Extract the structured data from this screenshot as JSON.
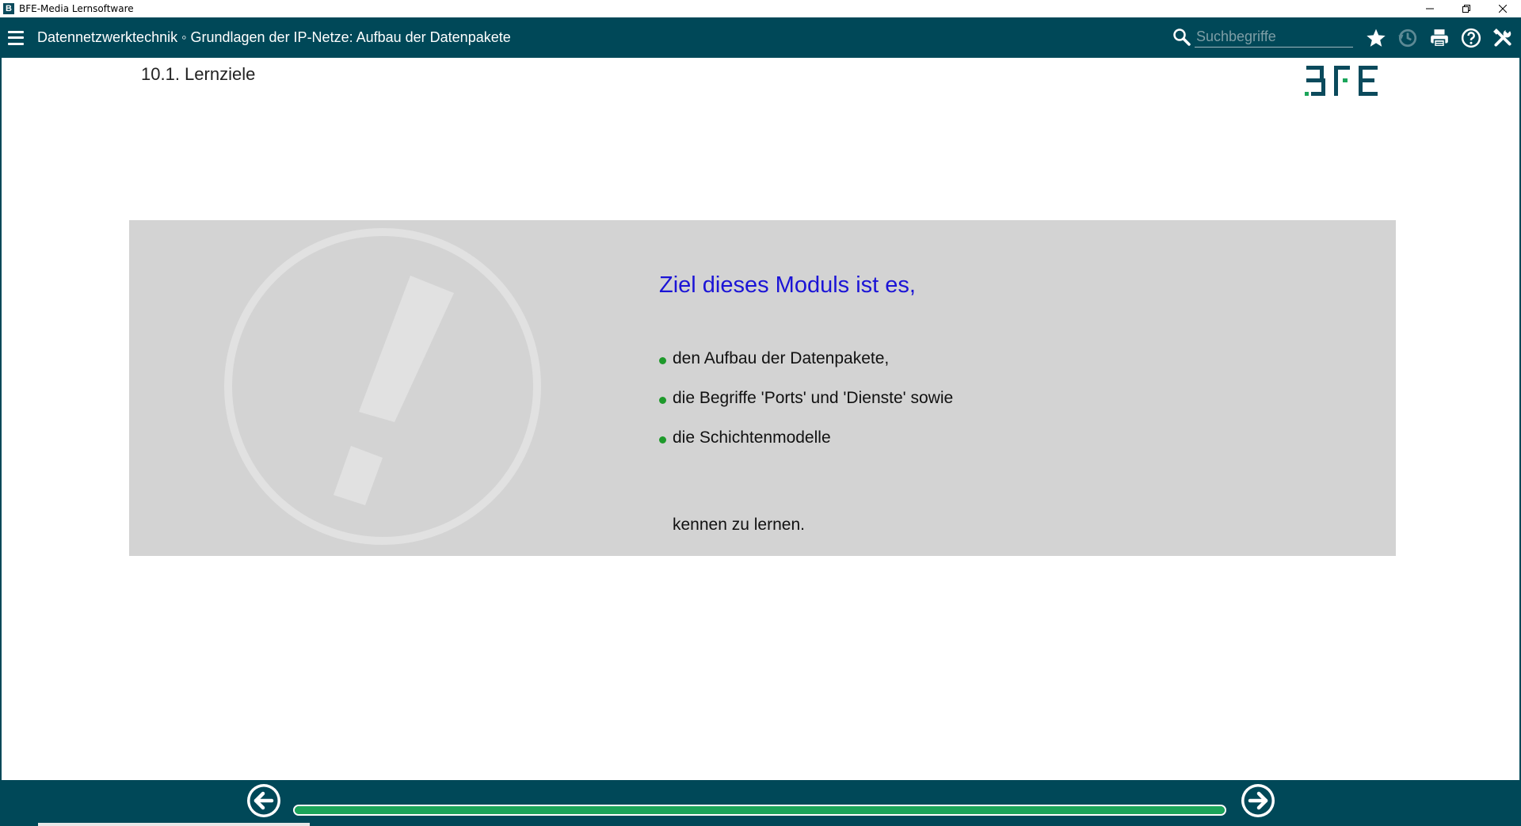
{
  "window": {
    "title": "BFE-Media Lernsoftware",
    "app_icon_letter": "B"
  },
  "toolbar": {
    "breadcrumb": "Datennetzwerktechnik ◦ Grundlagen der IP-Netze: Aufbau der Datenpakete",
    "search_placeholder": "Suchbegriffe",
    "search_value": "",
    "icons": [
      "star-icon",
      "history-icon",
      "print-icon",
      "help-icon",
      "tools-icon"
    ]
  },
  "content": {
    "page_title": "10.1. Lernziele",
    "logo_text": "BFE",
    "goal_heading": "Ziel dieses Moduls ist es,",
    "goals": [
      "den Aufbau der Datenpakete,",
      "die Begriffe 'Ports' und 'Dienste' sowie",
      "die Schichtenmodelle"
    ],
    "goal_footer": "kennen zu lernen."
  },
  "navigation": {
    "progress_fraction": 1.0
  },
  "colors": {
    "toolbar_bg": "#004858",
    "panel_bg": "#d3d3d3",
    "heading_blue": "#1b14d6",
    "bullet_green": "#1e9a2b",
    "progress_green": "#1ba55a"
  }
}
